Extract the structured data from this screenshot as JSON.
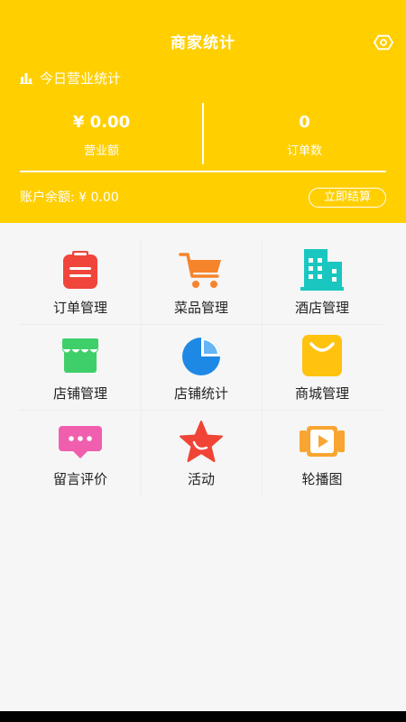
{
  "header": {
    "title": "商家统计",
    "today_label": "今日营业统计",
    "revenue_value": "¥ 0.00",
    "revenue_label": "营业额",
    "orders_value": "0",
    "orders_label": "订单数",
    "balance_text": "账户余额: ¥ 0.00",
    "settle_label": "立即结算"
  },
  "menu": {
    "items": [
      {
        "label": "订单管理",
        "icon": "clipboard-icon",
        "color": "#f0453a"
      },
      {
        "label": "菜品管理",
        "icon": "cart-icon",
        "color": "#f6842b"
      },
      {
        "label": "酒店管理",
        "icon": "building-icon",
        "color": "#19c7c0"
      },
      {
        "label": "店铺管理",
        "icon": "shop-icon",
        "color": "#3fcf6a"
      },
      {
        "label": "店铺统计",
        "icon": "pie-chart-icon",
        "color": "#1e88e5"
      },
      {
        "label": "商城管理",
        "icon": "shopping-bag-icon",
        "color": "#ffc20e"
      },
      {
        "label": "留言评价",
        "icon": "message-icon",
        "color": "#f05fae"
      },
      {
        "label": "活动",
        "icon": "star-icon",
        "color": "#f04436"
      },
      {
        "label": "轮播图",
        "icon": "video-play-icon",
        "color": "#f8a531"
      }
    ]
  },
  "colors": {
    "header_bg": "#ffcf00",
    "page_bg": "#f6f6f6"
  }
}
